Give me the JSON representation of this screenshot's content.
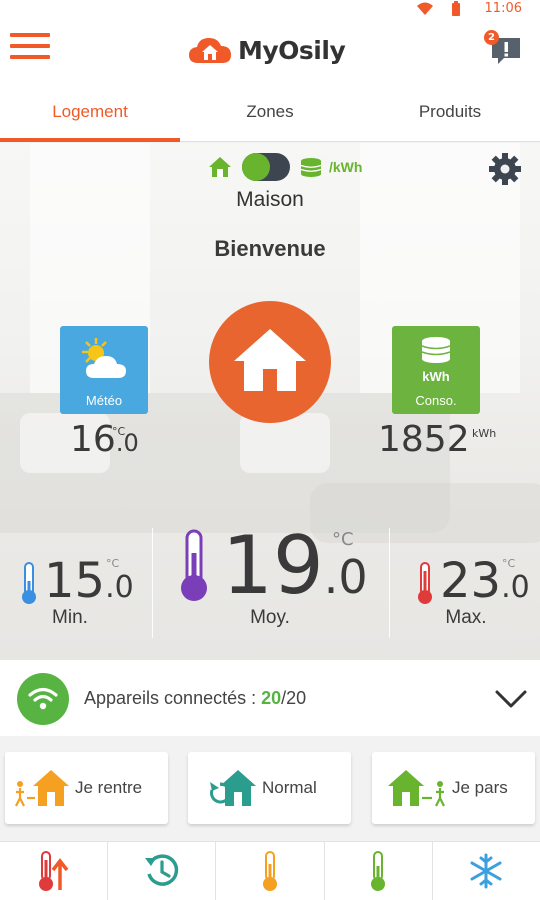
{
  "status_bar": {
    "time": "11:06"
  },
  "header": {
    "app_name": "MyOsily",
    "notification_count": "2"
  },
  "tabs": [
    {
      "label": "Logement",
      "active": true
    },
    {
      "label": "Zones",
      "active": false
    },
    {
      "label": "Produits",
      "active": false
    }
  ],
  "mode_toggle": {
    "unit": "/kWh"
  },
  "home": {
    "name": "Maison",
    "welcome": "Bienvenue"
  },
  "weather": {
    "label": "Météo",
    "value_int": "16",
    "value_dec": ".0",
    "unit": "°C"
  },
  "consumption": {
    "label": "Conso.",
    "tile_unit": "kWh",
    "value": "1852",
    "unit": "kWh"
  },
  "temperatures": {
    "min": {
      "label": "Min.",
      "value_int": "15",
      "value_dec": ".0",
      "unit": "°C",
      "color": "#3b8fe0"
    },
    "avg": {
      "label": "Moy.",
      "value_int": "19",
      "value_dec": ".0",
      "unit": "°C",
      "color": "#7a3fb8"
    },
    "max": {
      "label": "Max.",
      "value_int": "23",
      "value_dec": ".0",
      "unit": "°C",
      "color": "#e03b3b"
    }
  },
  "devices": {
    "label": "Appareils connectés :",
    "connected": "20",
    "total": "/20"
  },
  "modes": [
    {
      "label": "Je rentre"
    },
    {
      "label": "Normal"
    },
    {
      "label": "Je pars"
    }
  ],
  "bottom_bar": [
    {
      "icon": "boost-heat-icon"
    },
    {
      "icon": "schedule-icon"
    },
    {
      "icon": "comfort-temp-icon"
    },
    {
      "icon": "eco-temp-icon"
    },
    {
      "icon": "frost-protection-icon"
    }
  ],
  "colors": {
    "accent": "#f05a28",
    "green": "#69b42e",
    "weather": "#4aa8e0"
  }
}
